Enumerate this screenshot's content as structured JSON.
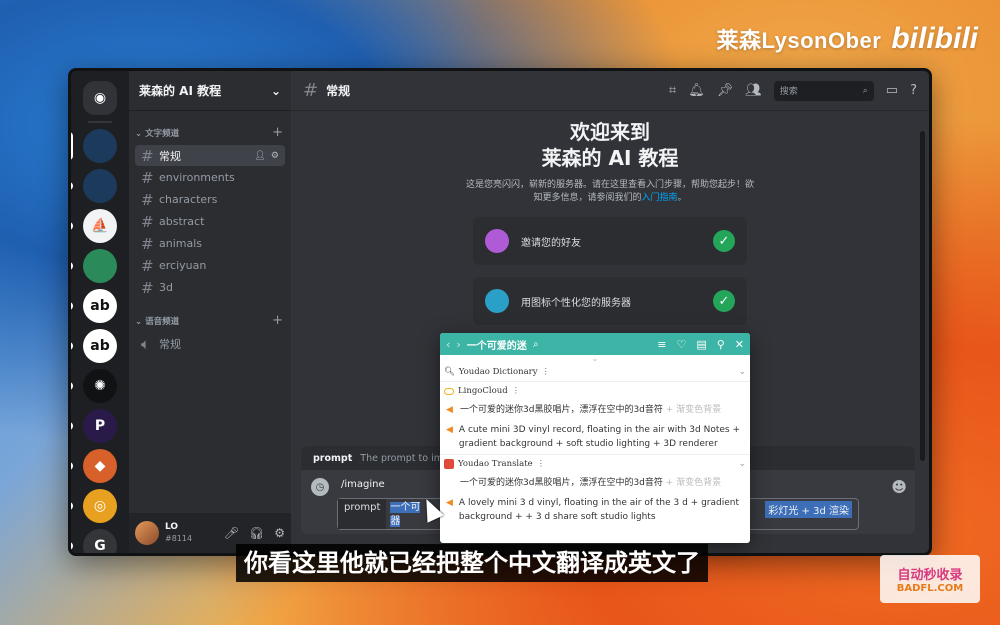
{
  "brand": {
    "name": "莱森LysonOber",
    "logo": "bilibili"
  },
  "servers": [
    {
      "name": "discord-home",
      "color": "#313338",
      "glyph": "◉"
    },
    {
      "name": "server-1",
      "color": "#1b3a5c",
      "glyph": ""
    },
    {
      "name": "server-2",
      "color": "#1b3a5c",
      "glyph": ""
    },
    {
      "name": "server-3",
      "color": "#f2f3f5",
      "glyph": "⛵"
    },
    {
      "name": "server-4",
      "color": "#2a8a5a",
      "glyph": ""
    },
    {
      "name": "server-5",
      "color": "#ffffff",
      "glyph": "ab"
    },
    {
      "name": "server-6",
      "color": "#ffffff",
      "glyph": "ab"
    },
    {
      "name": "server-7",
      "color": "#111214",
      "glyph": "✺"
    },
    {
      "name": "server-8",
      "color": "#2a1a4a",
      "glyph": "P"
    },
    {
      "name": "server-9",
      "color": "#d8602a",
      "glyph": "◆"
    },
    {
      "name": "server-10",
      "color": "#e8a020",
      "glyph": "◎"
    },
    {
      "name": "server-11",
      "color": "#333538",
      "glyph": "G"
    }
  ],
  "guild": {
    "name": "莱森的 AI 教程"
  },
  "categories": {
    "text": "文字频道",
    "voice": "语音频道"
  },
  "channels": [
    {
      "label": "常规",
      "active": true
    },
    {
      "label": "environments"
    },
    {
      "label": "characters"
    },
    {
      "label": "abstract"
    },
    {
      "label": "animals"
    },
    {
      "label": "erciyuan"
    },
    {
      "label": "3d"
    }
  ],
  "voice_channels": [
    {
      "label": "常规"
    }
  ],
  "user": {
    "name": "LO",
    "tag": "#8114"
  },
  "topbar": {
    "channel": "常规",
    "search_placeholder": "搜索"
  },
  "welcome": {
    "title_line1": "欢迎来到",
    "title_line2": "莱森的 AI 教程",
    "desc": "这是您亮闪闪，崭新的服务器。请在这里查看入门步骤，帮助您起步！欲知更多信息，请参阅我们的",
    "link": "入门指南",
    "desc_end": "。",
    "steps": [
      {
        "label": "邀请您的好友",
        "icon_color": "#b05bd6"
      },
      {
        "label": "用图标个性化您的服务器",
        "icon_color": "#2aa0c8"
      }
    ]
  },
  "command": {
    "hint_name": "prompt",
    "hint_desc": "The prompt to imagine",
    "slash": "/imagine",
    "option_name": "prompt",
    "value_start": "一个可",
    "value_tail": "彩灯光 + 3d 渲染",
    "value_wrap": "器"
  },
  "popup": {
    "query": "一个可爱的迷",
    "sections": {
      "youdao_dict": "Youdao Dictionary",
      "lingocloud": "LingoCloud",
      "youdao_translate": "Youdao Translate"
    },
    "lingo_src": "一个可爱的迷你3d黑胶唱片，漂浮在空中的3d音符",
    "lingo_src_fade": " + 渐变色背景",
    "lingo_en": "A cute mini 3D vinyl record, floating in the air with 3d Notes + gradient background + soft studio lighting + 3D renderer",
    "yt_src": "一个可爱的迷你3d黑胶唱片，漂浮在空中的3d音符",
    "yt_src_fade": " + 渐变色背景",
    "yt_en": "A lovely mini 3 d vinyl, floating in the air of the 3 d + gradient background + + 3 d share soft studio lights"
  },
  "subtitle": "你看这里他就已经把整个中文翻译成英文了",
  "watermark": {
    "line1": "自动秒收录",
    "line2": "BADFL.COM"
  }
}
